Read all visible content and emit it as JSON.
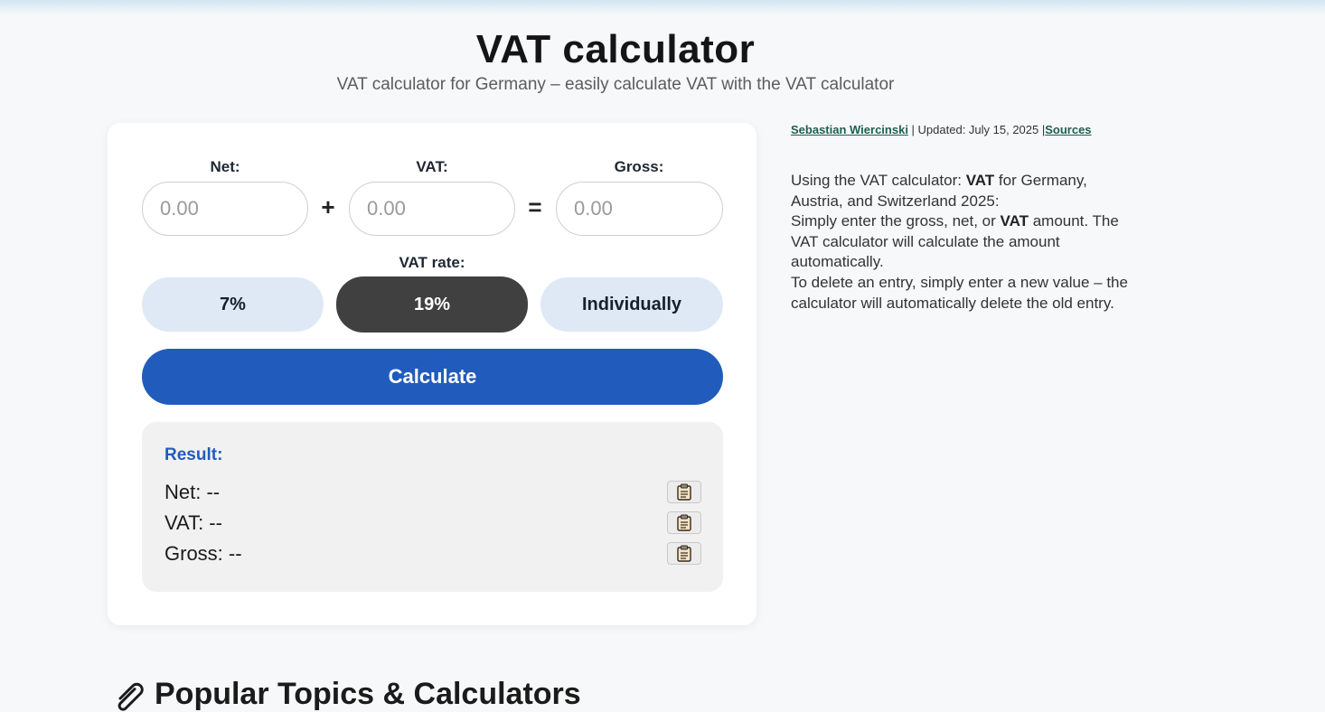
{
  "header": {
    "title": "VAT calculator",
    "subtitle": "VAT calculator for Germany – easily calculate VAT with the VAT calculator"
  },
  "calculator": {
    "fields": [
      {
        "label": "Net:",
        "placeholder": "0.00",
        "value": ""
      },
      {
        "label": "VAT:",
        "placeholder": "0.00",
        "value": ""
      },
      {
        "label": "Gross:",
        "placeholder": "0.00",
        "value": ""
      }
    ],
    "operators": {
      "plus": "+",
      "equals": "="
    },
    "rate_label": "VAT rate:",
    "rates": [
      {
        "label": "7%",
        "active": false
      },
      {
        "label": "19%",
        "active": true
      },
      {
        "label": "Individually",
        "active": false
      }
    ],
    "calculate_label": "Calculate",
    "result": {
      "title": "Result:",
      "rows": [
        {
          "label": "Net: --"
        },
        {
          "label": "VAT: --"
        },
        {
          "label": "Gross: --"
        }
      ]
    }
  },
  "meta": {
    "author": "Sebastian Wiercinski",
    "separator1": " | Updated: July 15, 2025 |",
    "sources": "Sources"
  },
  "description": {
    "p1_a": "Using the VAT calculator: ",
    "p1_b": "VAT",
    "p1_c": " for Germany, Austria, and Switzerland 2025:",
    "p2_a": "Simply enter the gross, net, or ",
    "p2_b": "VAT",
    "p2_c": " amount. The VAT calculator will calculate the amount automatically.",
    "p3": "To delete an entry, simply enter a new value – the calculator will automatically delete the old entry."
  },
  "section": {
    "heading": "Popular Topics & Calculators",
    "icon": "paperclip-icon"
  },
  "colors": {
    "accent": "#215cbc",
    "active_rate": "#404040",
    "inactive_rate": "#dfe9f6",
    "author_link": "#1e5f4f"
  }
}
